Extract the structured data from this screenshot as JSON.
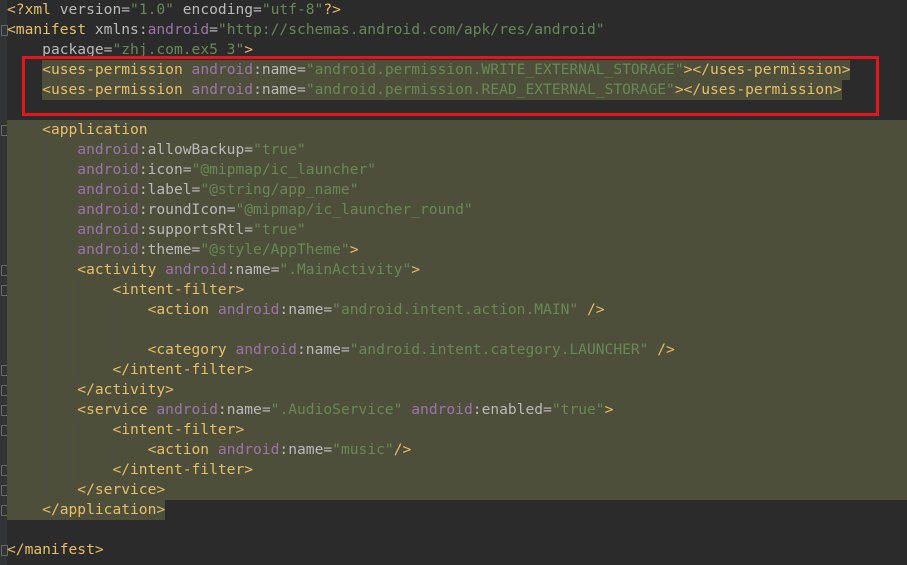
{
  "editor": {
    "file_type": "xml",
    "lines": [
      "<?xml version=\"1.0\" encoding=\"utf-8\"?>",
      "<manifest xmlns:android=\"http://schemas.android.com/apk/res/android\"",
      "    package=\"zhj.com.ex5_3\">",
      "    <uses-permission android:name=\"android.permission.WRITE_EXTERNAL_STORAGE\"></uses-permission>",
      "    <uses-permission android:name=\"android.permission.READ_EXTERNAL_STORAGE\"></uses-permission>",
      "",
      "    <application",
      "        android:allowBackup=\"true\"",
      "        android:icon=\"@mipmap/ic_launcher\"",
      "        android:label=\"@string/app_name\"",
      "        android:roundIcon=\"@mipmap/ic_launcher_round\"",
      "        android:supportsRtl=\"true\"",
      "        android:theme=\"@style/AppTheme\">",
      "        <activity android:name=\".MainActivity\">",
      "            <intent-filter>",
      "                <action android:name=\"android.intent.action.MAIN\" />",
      "",
      "                <category android:name=\"android.intent.category.LAUNCHER\" />",
      "            </intent-filter>",
      "        </activity>",
      "        <service android:name=\".AudioService\" android:enabled=\"true\">",
      "            <intent-filter>",
      "                <action android:name=\"music\"/>",
      "            </intent-filter>",
      "        </service>",
      "    </application>",
      "",
      "</manifest>"
    ]
  },
  "highlight": {
    "color": "#e3161e"
  },
  "colors": {
    "background": "#2b2b2b",
    "tag": "#e8bf6a",
    "namespace": "#9876aa",
    "attribute": "#bababa",
    "value": "#6a8759",
    "selection_bg": "#4e4f3b"
  }
}
